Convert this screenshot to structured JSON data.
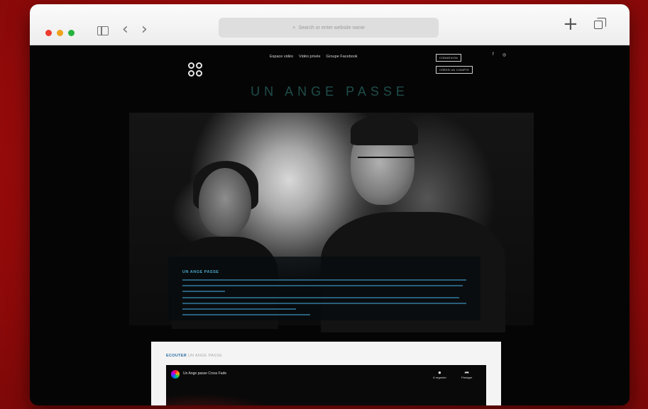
{
  "browser": {
    "url_placeholder": "Search or enter website name",
    "new_tab": "+",
    "back": "‹",
    "forward": "›"
  },
  "site": {
    "nav": [
      "Espace vidéo",
      "Vidéo privée",
      "Groupe Facebook"
    ],
    "login_label": "CONNEXION",
    "create_label": "CRÉER UN COMPTE",
    "social": [
      "f",
      "◎"
    ],
    "hero_title": "UN ANGE PASSE",
    "overlay_title": "UN ANGE PASSE",
    "listen": {
      "title": "ECOUTER",
      "subtitle": "UN ANGE PASSE"
    },
    "video": {
      "title": "Un Ange passe Cross Fade",
      "watch_later": "À regarder",
      "share": "Partager"
    }
  },
  "colors": {
    "background": "#a50d0d",
    "accent_blue": "#4aa6c7",
    "title_teal": "#1e4d4a"
  }
}
